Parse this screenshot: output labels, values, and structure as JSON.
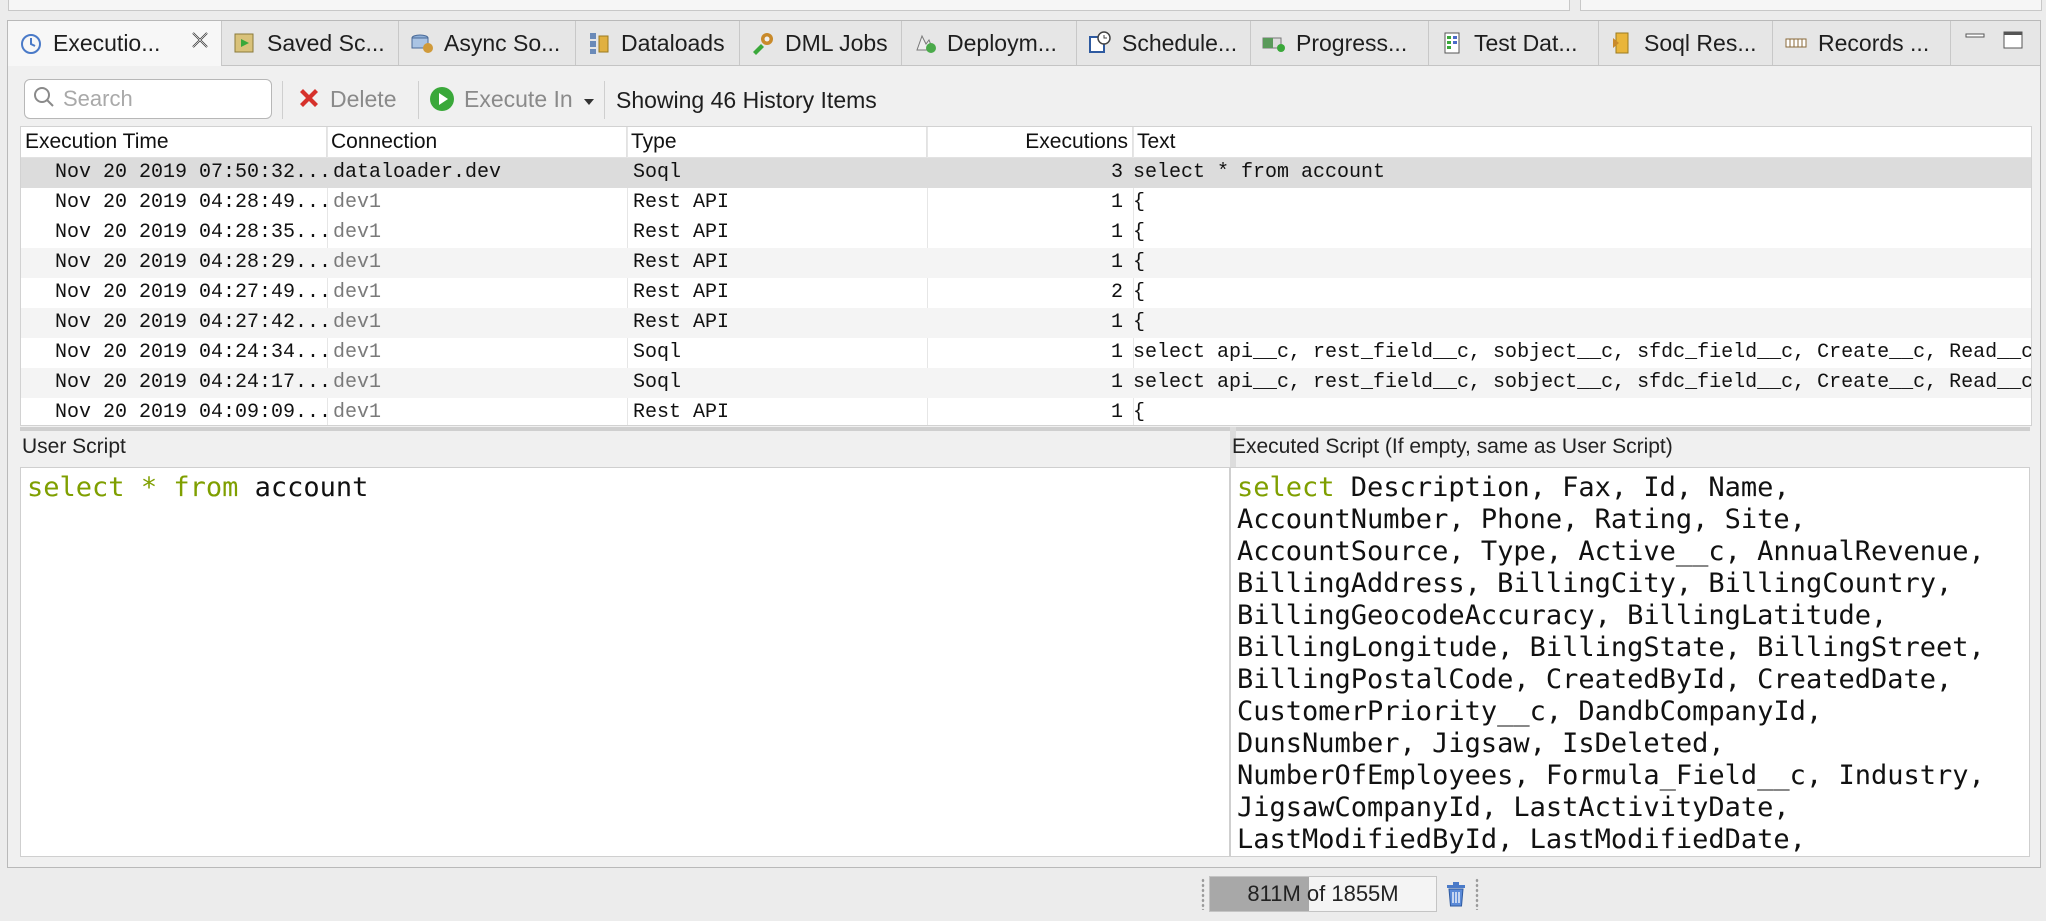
{
  "tabs": [
    {
      "label": "Executio...",
      "icon": "clock-icon",
      "active": true
    },
    {
      "label": "Saved Sc...",
      "icon": "saved-script-icon"
    },
    {
      "label": "Async So...",
      "icon": "async-soql-icon"
    },
    {
      "label": "Dataloads",
      "icon": "dataload-icon"
    },
    {
      "label": "DML Jobs",
      "icon": "dml-gear-icon"
    },
    {
      "label": "Deploym...",
      "icon": "deployment-icon"
    },
    {
      "label": "Schedule...",
      "icon": "schedule-icon"
    },
    {
      "label": "Progress...",
      "icon": "progress-icon"
    },
    {
      "label": "Test Dat...",
      "icon": "test-data-icon"
    },
    {
      "label": "Soql Res...",
      "icon": "soql-result-icon"
    },
    {
      "label": "Records ...",
      "icon": "records-icon"
    }
  ],
  "toolbar": {
    "search_placeholder": "Search",
    "delete_label": "Delete",
    "execute_label": "Execute In",
    "history_info": "Showing 46 History Items"
  },
  "table": {
    "columns": [
      "Execution Time",
      "Connection",
      "Type",
      "Executions",
      "Text"
    ],
    "rows": [
      {
        "time": "Nov 20 2019 07:50:32...",
        "connection": "dataloader.dev",
        "type": "Soql",
        "executions": "3",
        "text": "select * from account"
      },
      {
        "time": "Nov 20 2019 04:28:49...",
        "connection": "dev1",
        "type": "Rest API",
        "executions": "1",
        "text": "{"
      },
      {
        "time": "Nov 20 2019 04:28:35...",
        "connection": "dev1",
        "type": "Rest API",
        "executions": "1",
        "text": "{"
      },
      {
        "time": "Nov 20 2019 04:28:29...",
        "connection": "dev1",
        "type": "Rest API",
        "executions": "1",
        "text": "{"
      },
      {
        "time": "Nov 20 2019 04:27:49...",
        "connection": "dev1",
        "type": "Rest API",
        "executions": "2",
        "text": "{"
      },
      {
        "time": "Nov 20 2019 04:27:42...",
        "connection": "dev1",
        "type": "Rest API",
        "executions": "1",
        "text": "{"
      },
      {
        "time": "Nov 20 2019 04:24:34...",
        "connection": "dev1",
        "type": "Soql",
        "executions": "1",
        "text": "select api__c, rest_field__c, sobject__c, sfdc_field__c, Create__c, Read__c"
      },
      {
        "time": "Nov 20 2019 04:24:17...",
        "connection": "dev1",
        "type": "Soql",
        "executions": "1",
        "text": "select api__c, rest_field__c, sobject__c, sfdc_field__c, Create__c, Read__c"
      },
      {
        "time": "Nov 20 2019 04:09:09...",
        "connection": "dev1",
        "type": "Rest API",
        "executions": "1",
        "text": "{"
      }
    ]
  },
  "user_script": {
    "label": "User Script",
    "keyword1": "select",
    "operator": "*",
    "keyword2": "from",
    "rest": "account"
  },
  "executed_script": {
    "label": "Executed Script (If empty, same as User Script)",
    "keyword": "select",
    "body": " Description, Fax, Id, Name,\nAccountNumber, Phone, Rating, Site,\nAccountSource, Type, Active__c, AnnualRevenue,\nBillingAddress, BillingCity, BillingCountry,\nBillingGeocodeAccuracy, BillingLatitude,\nBillingLongitude, BillingState, BillingStreet,\nBillingPostalCode, CreatedById, CreatedDate,\nCustomerPriority__c, DandbCompanyId,\nDunsNumber, Jigsaw, IsDeleted,\nNumberOfEmployees, Formula_Field__c, Industry,\nJigsawCompanyId, LastActivityDate,\nLastModifiedById, LastModifiedDate,"
  },
  "status": {
    "heap_used": "811M",
    "heap_text": "811M of 1855M",
    "heap_fraction": 0.437
  },
  "colors": {
    "keyword": "#7f9f00",
    "selected_row": "#dcdcdc",
    "delete_red": "#d6312b",
    "execute_green": "#3aa83a"
  }
}
